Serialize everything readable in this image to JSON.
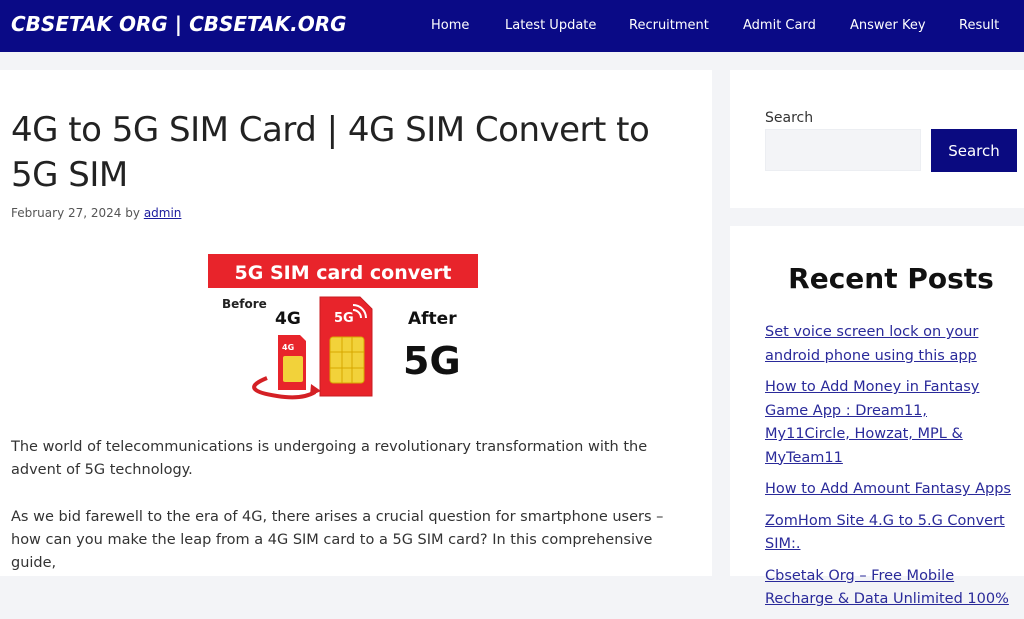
{
  "header": {
    "site_title": "CBSETAK ORG | CBSETAK.ORG",
    "nav": [
      {
        "label": "Home"
      },
      {
        "label": "Latest Update"
      },
      {
        "label": "Recruitment"
      },
      {
        "label": "Admit Card"
      },
      {
        "label": "Answer Key"
      },
      {
        "label": "Result"
      }
    ],
    "brand_color": "#0a0a86"
  },
  "article": {
    "title": "4G to 5G SIM Card | 4G SIM Convert to 5G SIM",
    "date": "February 27, 2024",
    "by": "by",
    "author": "admin",
    "hero": {
      "banner": "5G SIM card convert",
      "before_label": "Before",
      "old_network": "4G",
      "after_label": "After",
      "new_network": "5G",
      "small_sim_label": "4G",
      "big_sim_label": "5G",
      "accent_color": "#e8242b"
    },
    "paragraphs": [
      "The world of telecommunications is undergoing a revolutionary transformation with the advent of 5G technology.",
      "As we bid farewell to the era of 4G, there arises a crucial question for smartphone users – how can you make the leap from a 4G SIM card to a 5G SIM card? In this comprehensive guide,"
    ]
  },
  "sidebar": {
    "search": {
      "label": "Search",
      "input_value": "",
      "button_label": "Search"
    },
    "recent_posts": {
      "title": "Recent Posts",
      "items": [
        {
          "label": "Set voice screen lock on your android phone using this app"
        },
        {
          "label": "How to Add Money in Fantasy Game App : Dream11, My11Circle, Howzat, MPL & MyTeam11"
        },
        {
          "label": "How to Add Amount Fantasy Apps"
        },
        {
          "label": "ZomHom Site 4.G to 5.G Convert SIM:."
        },
        {
          "label": "Cbsetak Org – Free Mobile Recharge & Data Unlimited 100%"
        }
      ]
    }
  }
}
